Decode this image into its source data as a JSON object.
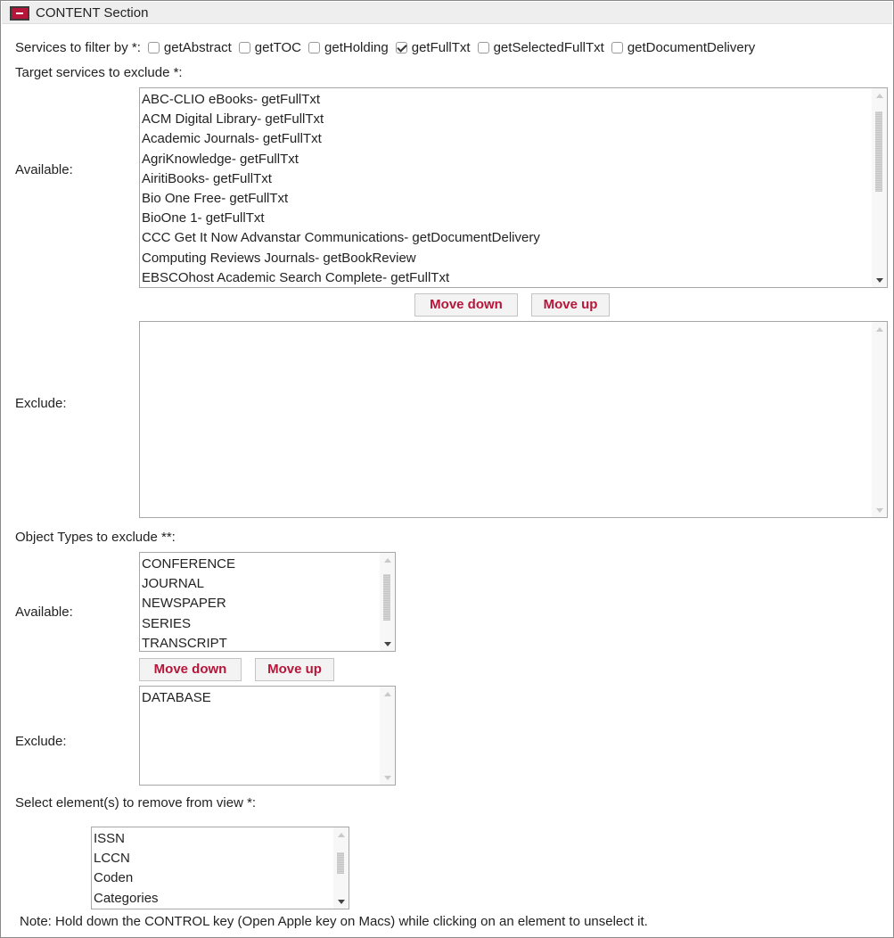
{
  "section": {
    "title": "CONTENT Section"
  },
  "services": {
    "label": "Services to filter by *:",
    "options": [
      {
        "label": "getAbstract",
        "checked": false
      },
      {
        "label": "getTOC",
        "checked": false
      },
      {
        "label": "getHolding",
        "checked": false
      },
      {
        "label": "getFullTxt",
        "checked": true
      },
      {
        "label": "getSelectedFullTxt",
        "checked": false
      },
      {
        "label": "getDocumentDelivery",
        "checked": false
      }
    ]
  },
  "target_services": {
    "heading": "Target services to exclude *:",
    "available_label": "Available:",
    "available_items": [
      "ABC-CLIO eBooks- getFullTxt",
      "ACM Digital Library- getFullTxt",
      "Academic Journals- getFullTxt",
      "AgriKnowledge- getFullTxt",
      "AiritiBooks- getFullTxt",
      "Bio One Free- getFullTxt",
      "BioOne 1- getFullTxt",
      "CCC Get It Now Advanstar Communications- getDocumentDelivery",
      "Computing Reviews Journals- getBookReview",
      "EBSCOhost Academic Search Complete- getFullTxt"
    ],
    "move_down_label": "Move down",
    "move_up_label": "Move up",
    "exclude_label": "Exclude:",
    "exclude_items": []
  },
  "object_types": {
    "heading": "Object Types to exclude **:",
    "available_label": "Available:",
    "available_items": [
      "CONFERENCE",
      "JOURNAL",
      "NEWSPAPER",
      "SERIES",
      "TRANSCRIPT"
    ],
    "move_down_label": "Move down",
    "move_up_label": "Move up",
    "exclude_label": "Exclude:",
    "exclude_items": [
      "DATABASE"
    ]
  },
  "remove_elements": {
    "heading": "Select element(s) to remove from view *:",
    "items": [
      "ISSN",
      "LCCN",
      "Coden",
      "Categories"
    ]
  },
  "note": "Note: Hold down the CONTROL key (Open Apple key on Macs) while clicking on an element to unselect it.",
  "colors": {
    "accent": "#b5163a",
    "header_bg": "#eeeeee",
    "border": "#a7a7a7"
  }
}
